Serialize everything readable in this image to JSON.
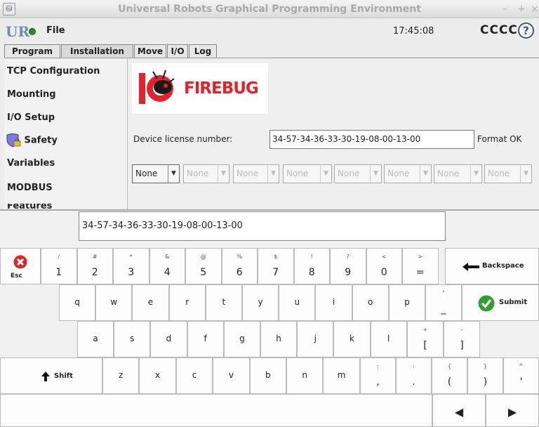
{
  "window": {
    "title": "Universal Robots Graphical Programming Environment",
    "controls": [
      "–",
      "+",
      "×"
    ]
  },
  "menubar": {
    "file": "File",
    "time": "17:45:08",
    "robot_name": "CCCC",
    "help": "?"
  },
  "tabs": [
    "Program",
    "Installation",
    "Move",
    "I/O",
    "Log"
  ],
  "sidebar": {
    "items": [
      "TCP Configuration",
      "Mounting",
      "I/O Setup",
      "Safety",
      "Variables",
      "MODBUS",
      "Features"
    ]
  },
  "firebug": {
    "brand": "FIREBUG",
    "license_label": "Device license number:",
    "license_value": "34-57-34-36-33-30-19-08-00-13-00",
    "status": "Format OK",
    "combo_values": [
      "None",
      "None",
      "None",
      "None",
      "None",
      "None",
      "None",
      "None"
    ]
  },
  "keyboard": {
    "input_value": "34-57-34-36-33-30-19-08-00-13-00",
    "esc": "Esc",
    "number_keys": [
      {
        "main": "1",
        "sub": "/"
      },
      {
        "main": "2",
        "sub": "#"
      },
      {
        "main": "3",
        "sub": "*"
      },
      {
        "main": "4",
        "sub": "&"
      },
      {
        "main": "5",
        "sub": "@"
      },
      {
        "main": "6",
        "sub": "%"
      },
      {
        "main": "7",
        "sub": "$"
      },
      {
        "main": "8",
        "sub": "!"
      },
      {
        "main": "9",
        "sub": "?"
      },
      {
        "main": "0",
        "sub": "<"
      },
      {
        "main": "=",
        "sub": ">"
      }
    ],
    "backspace": "Backspace",
    "row_q": [
      "q",
      "w",
      "e",
      "r",
      "t",
      "y",
      "u",
      "i",
      "o",
      "p"
    ],
    "underscore": {
      "main": "_",
      "sub": "\""
    },
    "submit": "Submit",
    "row_a": [
      "a",
      "s",
      "d",
      "f",
      "g",
      "h",
      "j",
      "k",
      "l"
    ],
    "bracket_keys": [
      {
        "main": "[",
        "sub": "+"
      },
      {
        "main": "]",
        "sub": "-"
      }
    ],
    "shift": "Shift",
    "row_z": [
      "z",
      "x",
      "c",
      "v",
      "b",
      "n",
      "m"
    ],
    "punct_keys": [
      {
        "main": ",",
        "sub": ";"
      },
      {
        "main": ".",
        "sub": ":"
      },
      {
        "main": "(",
        "sub": "{"
      },
      {
        "main": ")",
        "sub": "}"
      },
      {
        "main": "'",
        "sub": "^"
      }
    ],
    "left_arrow": "◀",
    "right_arrow": "▶"
  }
}
